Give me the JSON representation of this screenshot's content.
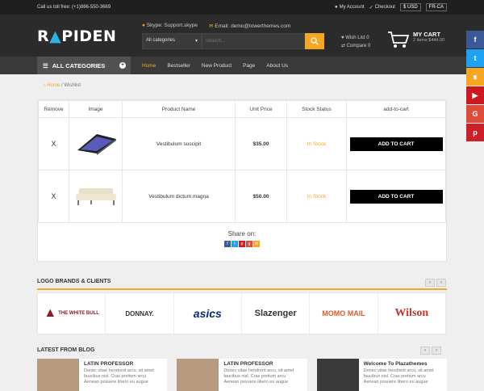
{
  "topbar": {
    "call": "Call us toll free: (+1)866-550-3669",
    "my_account": "My Account",
    "checkout": "Checkout",
    "currency": "$ USD",
    "language": "FR-CA"
  },
  "header": {
    "logo_part1": "R",
    "logo_part2": "PIDEN",
    "skype": "Skype: Support.skype",
    "email": "Email: demo@towerthemes.com",
    "search_category": "All categories",
    "search_placeholder": "Search...",
    "wishlist": "Wish List 0",
    "compare": "Compare 0",
    "cart_title": "MY CART",
    "cart_summary": "2 items $444.00"
  },
  "nav": {
    "all_categories": "ALL CATEGORIES",
    "items": [
      "Home",
      "Bestseller",
      "New Product",
      "Page",
      "About Us"
    ]
  },
  "breadcrumb": {
    "home": "Home",
    "separator": "/",
    "current": "Wishlist"
  },
  "table": {
    "headers": [
      "Remove",
      "Image",
      "Product Name",
      "Unit Price",
      "Stock Status",
      "add-to-cart"
    ],
    "rows": [
      {
        "remove": "X",
        "name": "Vestibulum suscipit",
        "price": "$35.00",
        "stock": "In Stock",
        "button": "ADD TO CART"
      },
      {
        "remove": "X",
        "name": "Vestibulum dictum magna",
        "price": "$50.00",
        "stock": "In Stock",
        "button": "ADD TO CART"
      }
    ]
  },
  "share": {
    "label": "Share on:"
  },
  "brands_section": {
    "title": "LOGO BRANDS & CLIENTS",
    "brands": [
      "THE WHITE BULL",
      "DONNAY.",
      "asics",
      "Slazenger",
      "MOMO MAIL",
      "Wilson"
    ]
  },
  "blog_section": {
    "title": "LATEST FROM BLOG",
    "posts": [
      {
        "title": "LATIN PROFESSOR",
        "l1": "Donec vitae hendrerit arcu, sit amet",
        "l2": "faucibus nisl. Cras pretium arcu",
        "l3": "Aenean posuere libero eu augue"
      },
      {
        "title": "LATIN PROFESSOR",
        "l1": "Donec vitae hendrerit arcu, sit amet",
        "l2": "faucibus nisl. Cras pretium arcu",
        "l3": "Aenean posuere libero eu augue"
      },
      {
        "title": "Welcome To Plazathemes",
        "l1": "Donec vitae hendrerit arcu, sit amet",
        "l2": "faucibus nisl. Cras pretium arcu",
        "l3": "Aenean posuere libero eu augue"
      }
    ]
  },
  "colors": {
    "accent": "#f5a623",
    "dark": "#2b2b2b",
    "nav": "#3a3a3a"
  }
}
